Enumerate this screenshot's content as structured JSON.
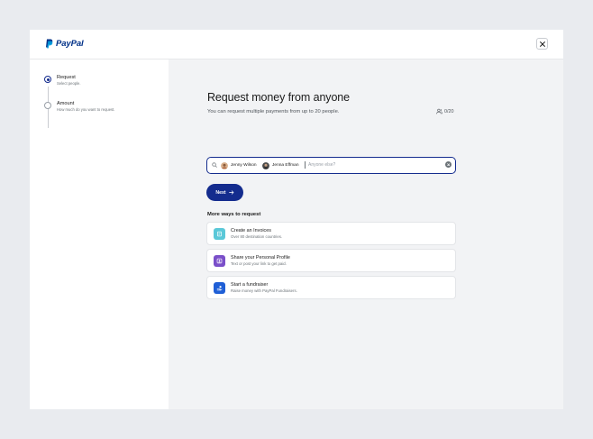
{
  "brand": {
    "name": "PayPal",
    "color": "#003087",
    "accent": "#142c8e"
  },
  "header": {
    "close_icon": "close-icon"
  },
  "steps": [
    {
      "title": "Request",
      "subtitle": "Select people.",
      "state": "active"
    },
    {
      "title": "Amount",
      "subtitle": "How much do you want to request.",
      "state": "pending"
    }
  ],
  "main": {
    "title": "Request money from anyone",
    "subtitle": "You can request multiple payments from up to 20 people.",
    "counter": "0/20",
    "search": {
      "recipients": [
        {
          "name": "Jenny Wilson"
        },
        {
          "name": "Jenna Effman"
        }
      ],
      "placeholder": "Anyone else?",
      "value": ""
    },
    "next_label": "Next",
    "more_title": "More ways to request",
    "options": [
      {
        "title": "Create an Invoices",
        "subtitle": "Over 80 destination countries.",
        "icon": "invoice-icon",
        "color": "#5ac8d8"
      },
      {
        "title": "Share your Personal Profile",
        "subtitle": "Text or post your link to get paid.",
        "icon": "profile-icon",
        "color": "#7a4fc9"
      },
      {
        "title": "Start a fundraiser",
        "subtitle": "Raise money with PayPal Fundraisers.",
        "icon": "fundraiser-icon",
        "color": "#1f5fd6"
      }
    ]
  }
}
